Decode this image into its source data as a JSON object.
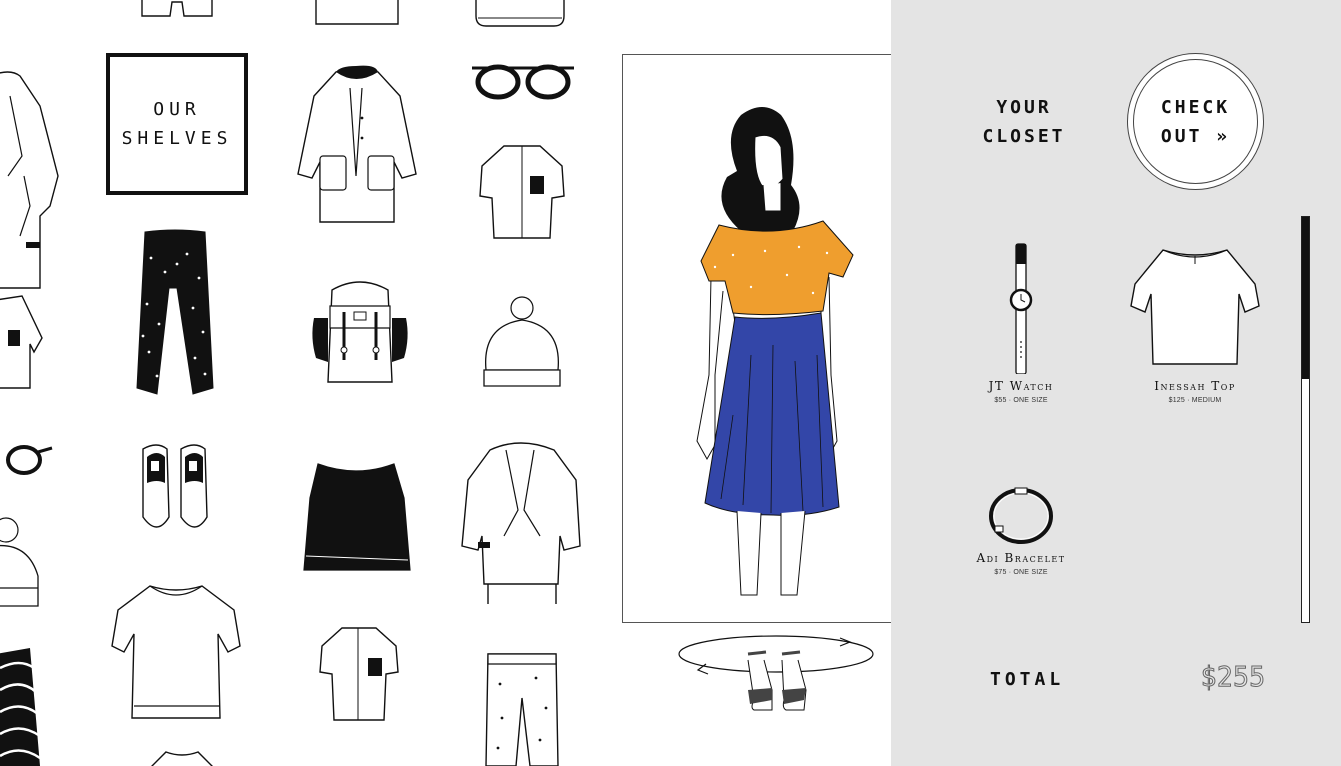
{
  "shelves": {
    "title": "OUR\nSHELVES"
  },
  "closet": {
    "title": "YOUR\nCLOSET",
    "checkout_label": "CHECK\nOUT »",
    "items": [
      {
        "name": "JT Watch",
        "price": "$55 · ONE SIZE",
        "icon": "watch-icon"
      },
      {
        "name": "Inessah Top",
        "price": "$125 · MEDIUM",
        "icon": "top-icon"
      },
      {
        "name": "Adi Bracelet",
        "price": "$75 · ONE SIZE",
        "icon": "bracelet-icon"
      }
    ],
    "scroll_position": 0.4,
    "total_label": "TOTAL",
    "total_value": "$255"
  },
  "colors": {
    "top": "#ef9e2e",
    "skirt": "#3346a8",
    "panel": "#e4e4e4",
    "ink": "#111111"
  },
  "icons": [
    "shirt-icon",
    "jacket-icon",
    "coat-icon",
    "glasses-icon",
    "pants-icon",
    "backpack-icon",
    "beanie-icon",
    "slip-on-shoes-icon",
    "crop-top-icon",
    "sweatshirt-icon",
    "rotate-icon"
  ]
}
